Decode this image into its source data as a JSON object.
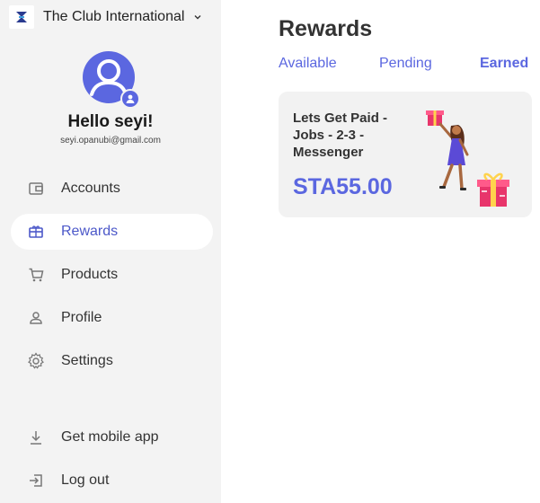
{
  "org": {
    "name": "The Club International"
  },
  "user": {
    "greeting": "Hello seyi!",
    "email": "seyi.opanubi@gmail.com"
  },
  "sidebar": {
    "items": [
      {
        "label": "Accounts",
        "icon": "wallet-icon"
      },
      {
        "label": "Rewards",
        "icon": "gift-card-icon",
        "active": true
      },
      {
        "label": "Products",
        "icon": "cart-icon"
      },
      {
        "label": "Profile",
        "icon": "person-icon"
      },
      {
        "label": "Settings",
        "icon": "gear-icon"
      }
    ],
    "bottom_items": [
      {
        "label": "Get mobile app",
        "icon": "download-icon"
      },
      {
        "label": "Log out",
        "icon": "logout-icon"
      }
    ]
  },
  "main": {
    "title": "Rewards",
    "tabs": [
      {
        "label": "Available"
      },
      {
        "label": "Pending"
      },
      {
        "label": "Earned",
        "active": true
      }
    ],
    "rewards": [
      {
        "title": "Lets Get Paid - Jobs - 2-3 - Messenger",
        "amount": "STA55.00"
      }
    ]
  },
  "colors": {
    "accent": "#5b67e0",
    "sidebar_bg": "#f3f3f3",
    "card_bg": "#f2f2f2"
  }
}
